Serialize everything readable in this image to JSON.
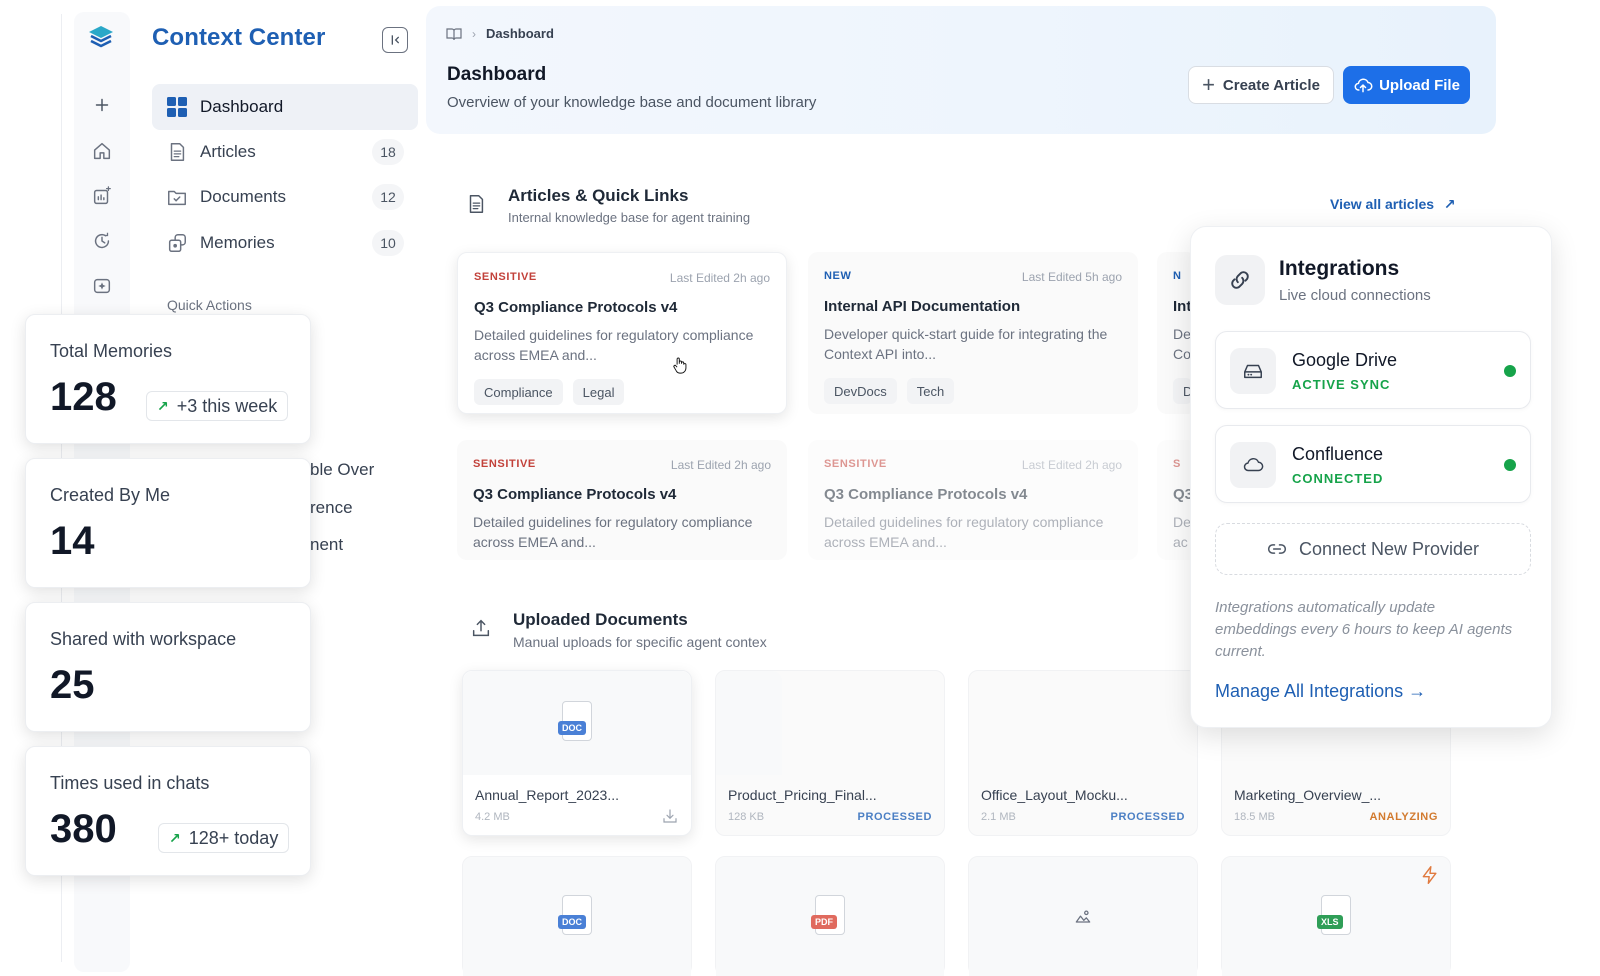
{
  "app": {
    "brand": "Context Center"
  },
  "nav": {
    "items": [
      {
        "label": "Dashboard",
        "icon": "grid-icon",
        "count": null,
        "active": true
      },
      {
        "label": "Articles",
        "icon": "file-text-icon",
        "count": "18"
      },
      {
        "label": "Documents",
        "icon": "folder-check-icon",
        "count": "12"
      },
      {
        "label": "Memories",
        "icon": "memory-icon",
        "count": "10"
      }
    ],
    "quick_actions_title": "Quick Actions",
    "partial_items": [
      "ble Over",
      "rence",
      "nent"
    ]
  },
  "header": {
    "breadcrumb_current": "Dashboard",
    "title": "Dashboard",
    "subtitle": "Overview of your knowledge base and document library",
    "create_label": "Create Article",
    "upload_label": "Upload File"
  },
  "articles": {
    "title": "Articles & Quick Links",
    "subtitle": "Internal knowledge base for agent training",
    "view_all": "View all articles",
    "cards": [
      {
        "tag": "SENSITIVE",
        "edited": "Last Edited 2h ago",
        "title": "Q3 Compliance Protocols v4",
        "desc": "Detailed guidelines for regulatory compliance across EMEA and...",
        "chips": [
          "Compliance",
          "Legal"
        ]
      },
      {
        "tag": "NEW",
        "edited": "Last Edited 5h ago",
        "title": "Internal API Documentation",
        "desc": "Developer quick-start guide for integrating the Context API into...",
        "chips": [
          "DevDocs",
          "Tech"
        ]
      },
      {
        "tag": "N",
        "title": "Int",
        "desc_1": "De",
        "desc_2": "Co",
        "chip": "D"
      },
      {
        "tag": "SENSITIVE",
        "edited": "Last Edited 2h ago",
        "title": "Q3 Compliance Protocols v4",
        "desc": "Detailed guidelines for regulatory compliance across EMEA and..."
      },
      {
        "tag": "SENSITIVE",
        "edited": "Last Edited 2h ago",
        "title": "Q3 Compliance Protocols v4",
        "desc": "Detailed guidelines for regulatory compliance across EMEA and..."
      },
      {
        "tag": "S",
        "title": "Q3",
        "desc_1": "De",
        "desc_2": "ac"
      }
    ]
  },
  "documents": {
    "title": "Uploaded Documents",
    "subtitle": "Manual uploads for specific agent contex",
    "files": [
      {
        "name": "Annual_Report_2023...",
        "size": "4.2 MB",
        "badge": "DOC",
        "status": ""
      },
      {
        "name": "Product_Pricing_Final...",
        "size": "128 KB",
        "status": "PROCESSED"
      },
      {
        "name": "Office_Layout_Mocku...",
        "size": "2.1 MB",
        "status": "PROCESSED"
      },
      {
        "name": "Marketing_Overview_...",
        "size": "18.5 MB",
        "status": "ANALYZING"
      }
    ],
    "row2_badges": [
      "DOC",
      "PDF",
      "",
      "XLS"
    ]
  },
  "integrations": {
    "title": "Integrations",
    "subtitle": "Live cloud connections",
    "providers": [
      {
        "name": "Google Drive",
        "status": "ACTIVE SYNC"
      },
      {
        "name": "Confluence",
        "status": "CONNECTED"
      }
    ],
    "connect_label": "Connect New Provider",
    "note": "Integrations automatically update embeddings every 6 hours to keep AI agents current.",
    "manage_label": "Manage All Integrations →"
  },
  "stats": [
    {
      "label": "Total Memories",
      "value": "128",
      "trend": "+3 this week"
    },
    {
      "label": "Created By Me",
      "value": "14"
    },
    {
      "label": "Shared with workspace",
      "value": "25"
    },
    {
      "label": "Times used in chats",
      "value": "380",
      "trend": "128+ today"
    }
  ],
  "colors": {
    "brand": "#1e5fb3",
    "primary": "#1d6fe8",
    "sensitive": "#c2413a",
    "success": "#16a34a",
    "analyzing": "#d27a2e"
  }
}
